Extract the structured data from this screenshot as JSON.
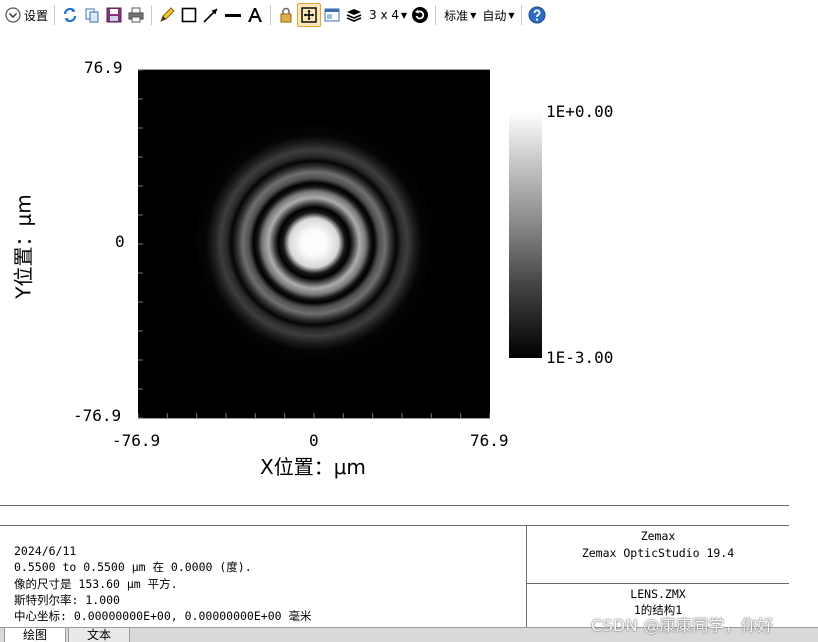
{
  "toolbar": {
    "settings_label": "设置",
    "layout_label": "3 x 4",
    "standard_label": "标准",
    "auto_label": "自动"
  },
  "plot": {
    "y_tick_top": "76.9",
    "y_tick_mid": "0",
    "y_tick_bottom": "-76.9",
    "x_tick_left": "-76.9",
    "x_tick_mid": "0",
    "x_tick_right": "76.9",
    "x_title": "X位置：μm",
    "y_title": "Y位置：μm",
    "colorbar_max": "1E+0.00",
    "colorbar_min": "1E-3.00"
  },
  "info": {
    "date": "2024/6/11",
    "wavelength": "0.5500 to 0.5500 μm 在 0.0000 (度).",
    "image_size": "像的尺寸是 153.60 μm 平方.",
    "strehl": "斯特列尔率: 1.000",
    "center": "中心坐标:   0.00000000E+00,   0.00000000E+00 毫米",
    "company": "Zemax",
    "product": "Zemax OpticStudio 19.4",
    "file": "LENS.ZMX",
    "config": "1的结构1"
  },
  "tabs": {
    "draw": "绘图",
    "text": "文本"
  },
  "watermark": "CSDN @康康同学，你好",
  "colors": {
    "toolbar_accent": "#e8a33c",
    "background": "#ffffff",
    "plot_background": "#000000"
  }
}
